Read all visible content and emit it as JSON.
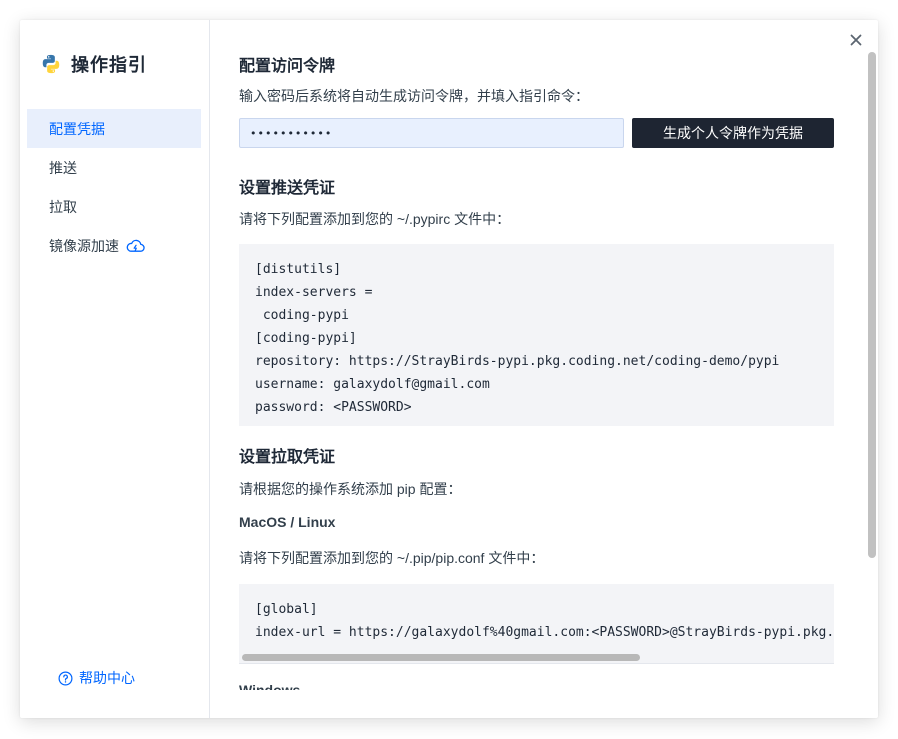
{
  "sidebar": {
    "title": "操作指引",
    "items": [
      {
        "label": "配置凭据"
      },
      {
        "label": "推送"
      },
      {
        "label": "拉取"
      },
      {
        "label": "镜像源加速"
      }
    ],
    "help_label": "帮助中心"
  },
  "main": {
    "token_section": {
      "heading": "配置访问令牌",
      "desc": "输入密码后系统将自动生成访问令牌，并填入指引命令：",
      "password_value": "•••••••••••",
      "generate_button": "生成个人令牌作为凭据"
    },
    "push_section": {
      "heading": "设置推送凭证",
      "desc": "请将下列配置添加到您的 ~/.pypirc 文件中：",
      "code": "[distutils]\nindex-servers =\n coding-pypi\n[coding-pypi]\nrepository: https://StrayBirds-pypi.pkg.coding.net/coding-demo/pypi\nusername: galaxydolf@gmail.com\npassword: <PASSWORD>"
    },
    "pull_section": {
      "heading": "设置拉取凭证",
      "desc": "请根据您的操作系统添加 pip 配置：",
      "os_label": "MacOS / Linux",
      "file_desc": "请将下列配置添加到您的 ~/.pip/pip.conf 文件中：",
      "code": "[global]\nindex-url = https://galaxydolf%40gmail.com:<PASSWORD>@StrayBirds-pypi.pkg.coding.net/coding-demo/pypi/simple",
      "next_os_label": "Windows"
    }
  },
  "colors": {
    "accent": "#0066ff",
    "active_bg": "#e8effc",
    "button_bg": "#1e2532",
    "code_bg": "#f3f4f7"
  }
}
